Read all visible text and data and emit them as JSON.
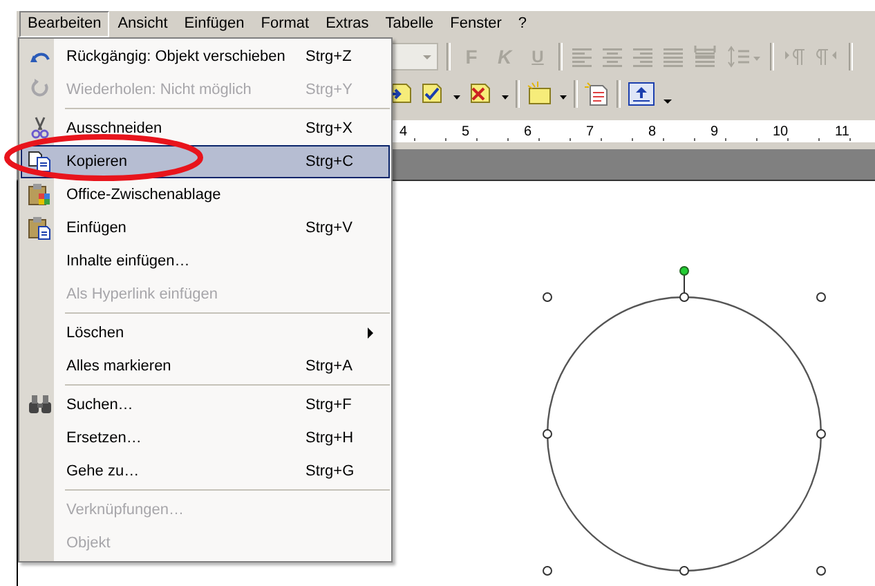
{
  "menubar": [
    {
      "label": "Bearbeiten",
      "selected": true
    },
    {
      "label": "Ansicht",
      "selected": false
    },
    {
      "label": "Einfügen",
      "selected": false
    },
    {
      "label": "Format",
      "selected": false
    },
    {
      "label": "Extras",
      "selected": false
    },
    {
      "label": "Tabelle",
      "selected": false
    },
    {
      "label": "Fenster",
      "selected": false
    },
    {
      "label": "?",
      "selected": false
    }
  ],
  "formatting_toolbar": [
    {
      "label": "F",
      "kind": "bold"
    },
    {
      "label": "K",
      "kind": "italic"
    },
    {
      "label": "U",
      "kind": "underline"
    }
  ],
  "ruler": {
    "labels": [
      "4",
      "5",
      "6",
      "7",
      "8",
      "9",
      "10",
      "11"
    ]
  },
  "menu": {
    "items": [
      {
        "kind": "command",
        "label": "Rückgängig: Objekt verschieben",
        "shortcut": "Strg+Z",
        "disabled": false,
        "selected": false
      },
      {
        "kind": "command",
        "label": "Wiederholen: Nicht möglich",
        "shortcut": "Strg+Y",
        "disabled": true,
        "selected": false
      },
      {
        "kind": "separator"
      },
      {
        "kind": "command",
        "label": "Ausschneiden",
        "shortcut": "Strg+X",
        "disabled": false,
        "selected": false
      },
      {
        "kind": "command",
        "label": "Kopieren",
        "shortcut": "Strg+C",
        "disabled": false,
        "selected": true
      },
      {
        "kind": "command",
        "label": "Office-Zwischenablage",
        "disabled": false,
        "selected": false
      },
      {
        "kind": "command",
        "label": "Einfügen",
        "shortcut": "Strg+V",
        "disabled": false,
        "selected": false
      },
      {
        "kind": "command",
        "label": "Inhalte einfügen…",
        "disabled": false,
        "selected": false
      },
      {
        "kind": "command",
        "label": "Als Hyperlink einfügen",
        "disabled": true,
        "selected": false
      },
      {
        "kind": "separator"
      },
      {
        "kind": "submenu",
        "label": "Löschen",
        "disabled": false,
        "selected": false
      },
      {
        "kind": "command",
        "label": "Alles markieren",
        "shortcut": "Strg+A",
        "disabled": false,
        "selected": false
      },
      {
        "kind": "separator"
      },
      {
        "kind": "command",
        "label": "Suchen…",
        "shortcut": "Strg+F",
        "disabled": false,
        "selected": false
      },
      {
        "kind": "command",
        "label": "Ersetzen…",
        "shortcut": "Strg+H",
        "disabled": false,
        "selected": false
      },
      {
        "kind": "command",
        "label": "Gehe zu…",
        "shortcut": "Strg+G",
        "disabled": false,
        "selected": false
      },
      {
        "kind": "separator"
      },
      {
        "kind": "command",
        "label": "Verknüpfungen…",
        "disabled": true,
        "selected": false
      },
      {
        "kind": "command",
        "label": "Objekt",
        "disabled": true,
        "selected": false
      }
    ]
  }
}
